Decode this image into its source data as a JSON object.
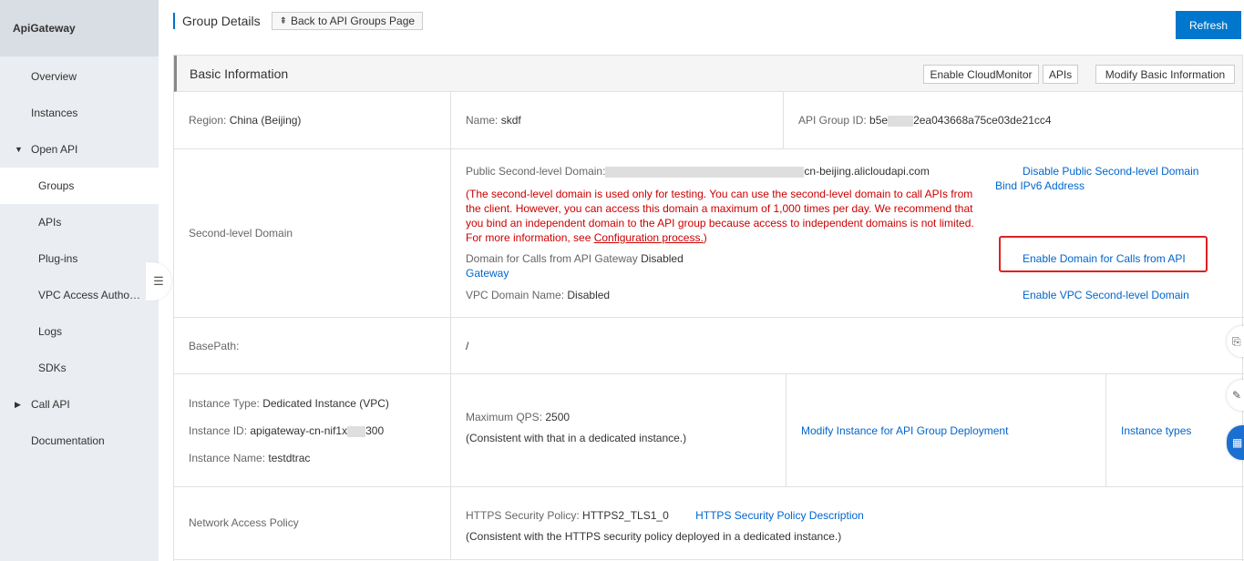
{
  "sidebar": {
    "title": "ApiGateway",
    "items": [
      {
        "label": "Overview"
      },
      {
        "label": "Instances"
      },
      {
        "label": "Open API"
      },
      {
        "label": "Groups"
      },
      {
        "label": "APIs"
      },
      {
        "label": "Plug-ins"
      },
      {
        "label": "VPC Access Autho…"
      },
      {
        "label": "Logs"
      },
      {
        "label": "SDKs"
      },
      {
        "label": "Call API"
      },
      {
        "label": "Documentation"
      }
    ],
    "collapse_icon": "☰"
  },
  "header": {
    "title": "Group Details",
    "back_label": "Back to API Groups Page",
    "back_icon": "⇞",
    "refresh_label": "Refresh"
  },
  "card": {
    "title": "Basic Information",
    "buttons": {
      "cloudmonitor": "Enable CloudMonitor",
      "apis": "APIs",
      "modify": "Modify Basic Information"
    }
  },
  "basic": {
    "region_label": "Region:",
    "region_value": "China (Beijing)",
    "name_label": "Name:",
    "name_value": "skdf",
    "group_id_label": "API Group ID:",
    "group_id_prefix": "b5e",
    "group_id_mid": "2ea043668a75ce03de21cc4"
  },
  "second_level": {
    "label": "Second-level Domain",
    "public_label": "Public Second-level Domain:",
    "public_suffix": "cn-beijing.alicloudapi.com",
    "warning_lines": [
      "(The second-level domain is used only for testing. You can use the second-level domain to call APIs from",
      "the client. However, you can access this domain a maximum of 1,000 times per day. We recommend that",
      "you bind an independent domain to the API group because access to independent domains is not limited.",
      "For more information, see "
    ],
    "warning_link": "Configuration process.",
    "warning_end": ")",
    "calls_label": "Domain for Calls from API Gateway",
    "calls_value": "Disabled",
    "calls_link": "Gateway",
    "vpc_label": "VPC Domain Name:",
    "vpc_value": "Disabled",
    "disable_public": "Disable Public Second-level Domain",
    "bind_ipv6": "Bind IPv6 Address",
    "enable_calls": "Enable Domain for Calls from API",
    "enable_vpc": "Enable VPC Second-level Domain"
  },
  "basepath": {
    "label": "BasePath:",
    "value": "/"
  },
  "instance": {
    "type_label": "Instance Type:",
    "type_value": "Dedicated Instance (VPC)",
    "id_label": "Instance ID:",
    "id_value_prefix": "apigateway-cn-nif1x",
    "id_value_suffix": "300",
    "name_label": "Instance Name:",
    "name_value": "testdtrac",
    "qps_label": "Maximum QPS:",
    "qps_value": "2500",
    "qps_note": "(Consistent with that in a dedicated instance.)",
    "modify_link": "Modify Instance for API Group Deployment",
    "types_link": "Instance types"
  },
  "network": {
    "label": "Network Access Policy",
    "https_label": "HTTPS Security Policy:",
    "https_value": "HTTPS2_TLS1_0",
    "https_link": "HTTPS Security Policy Description",
    "https_note": "(Consistent with the HTTPS security policy deployed in a dedicated instance.)"
  },
  "float_icons": [
    "⎘",
    "✎",
    "▦"
  ]
}
